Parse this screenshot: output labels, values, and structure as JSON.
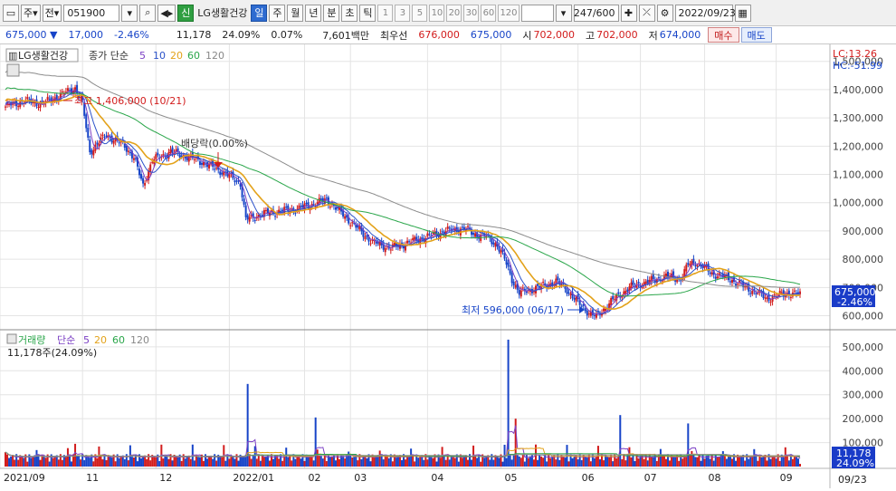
{
  "toolbar": {
    "type_label": "주",
    "prefix_label": "전",
    "code": "051900",
    "new_badge": "신",
    "stock_name": "LG생활건강",
    "periods": [
      "일",
      "주",
      "월",
      "년",
      "분",
      "초",
      "틱"
    ],
    "active_period_index": 0,
    "intervals": [
      "1",
      "3",
      "5",
      "10",
      "20",
      "30",
      "60",
      "120"
    ],
    "count": "247/600",
    "date": "2022/09/23"
  },
  "quote": {
    "price": "675,000",
    "change": "17,000",
    "change_pct": "-2.46%",
    "volume": "11,178",
    "vol_ratio": "24.09%",
    "turnover": "0.07%",
    "amount": "7,601백만",
    "best_label": "최우선",
    "ask": "676,000",
    "bid": "675,000",
    "open_label": "시",
    "open": "702,000",
    "high_label": "고",
    "high": "702,000",
    "low_label": "저",
    "low": "674,000",
    "buy_label": "매수",
    "sell_label": "매도"
  },
  "price_panel": {
    "stock": "LG생활건강",
    "legend_prefix": "종가 단순",
    "ma_periods": [
      "5",
      "10",
      "20",
      "60",
      "120"
    ],
    "lc": "LC:13.26",
    "hc": "HC:-51.99",
    "last_price": "675,000",
    "last_change": "-2.46%",
    "high_note": "최고 1,406,000 (10/21)",
    "low_note": "최저 596,000 (06/17)",
    "dividend_note": "배당락(0.00%)"
  },
  "volume_panel": {
    "title": "거래량",
    "legend_prefix": "단순",
    "ma_periods": [
      "5",
      "20",
      "60",
      "120"
    ],
    "info": "11,178주(24.09%)",
    "last_volume": "11,178",
    "last_ratio": "24.09%"
  },
  "colors": {
    "up": "#d21c1c",
    "down": "#1744c8",
    "ma5": "#7b3fc4",
    "ma10": "#2b52c9",
    "ma20": "#e3a21a",
    "ma60": "#2aa64a",
    "ma120": "#8c8c8c"
  },
  "chart_data": {
    "type": "candlestick",
    "price_axis_ticks": [
      1500000,
      1400000,
      1300000,
      1200000,
      1100000,
      1000000,
      900000,
      800000,
      700000,
      600000
    ],
    "price_ylim": [
      560000,
      1560000
    ],
    "volume_axis_ticks": [
      500000,
      400000,
      300000,
      200000,
      100000
    ],
    "volume_ylim": [
      0,
      560000
    ],
    "x_tick_labels": [
      "2021/09",
      "11",
      "12",
      "2022/01",
      "02",
      "03",
      "04",
      "05",
      "06",
      "07",
      "08",
      "09"
    ],
    "current_date_label": "09/23",
    "close_anchors": [
      [
        0,
        1340000
      ],
      [
        10,
        1360000
      ],
      [
        20,
        1350000
      ],
      [
        30,
        1380000
      ],
      [
        38,
        1406000
      ],
      [
        42,
        1350000
      ],
      [
        46,
        1180000
      ],
      [
        55,
        1240000
      ],
      [
        65,
        1200000
      ],
      [
        70,
        1160000
      ],
      [
        75,
        1060000
      ],
      [
        80,
        1150000
      ],
      [
        90,
        1180000
      ],
      [
        105,
        1150000
      ],
      [
        118,
        1110000
      ],
      [
        128,
        1070000
      ],
      [
        131,
        940000
      ],
      [
        140,
        960000
      ],
      [
        160,
        980000
      ],
      [
        175,
        1010000
      ],
      [
        182,
        970000
      ],
      [
        190,
        920000
      ],
      [
        200,
        860000
      ],
      [
        210,
        840000
      ],
      [
        220,
        860000
      ],
      [
        230,
        880000
      ],
      [
        240,
        900000
      ],
      [
        250,
        910000
      ],
      [
        255,
        890000
      ],
      [
        262,
        880000
      ],
      [
        268,
        850000
      ],
      [
        272,
        800000
      ],
      [
        276,
        730000
      ],
      [
        280,
        680000
      ],
      [
        290,
        700000
      ],
      [
        300,
        720000
      ],
      [
        305,
        700000
      ],
      [
        310,
        660000
      ],
      [
        318,
        610000
      ],
      [
        322,
        596000
      ],
      [
        330,
        650000
      ],
      [
        340,
        700000
      ],
      [
        350,
        720000
      ],
      [
        360,
        740000
      ],
      [
        368,
        730000
      ],
      [
        372,
        780000
      ],
      [
        376,
        790000
      ],
      [
        385,
        750000
      ],
      [
        395,
        730000
      ],
      [
        403,
        700000
      ],
      [
        410,
        680000
      ],
      [
        415,
        660000
      ],
      [
        425,
        680000
      ],
      [
        433,
        675000
      ]
    ],
    "volume_spikes": [
      [
        38,
        95000
      ],
      [
        132,
        345000
      ],
      [
        169,
        205000
      ],
      [
        274,
        530000
      ],
      [
        278,
        200000
      ],
      [
        335,
        215000
      ],
      [
        372,
        180000
      ]
    ]
  }
}
